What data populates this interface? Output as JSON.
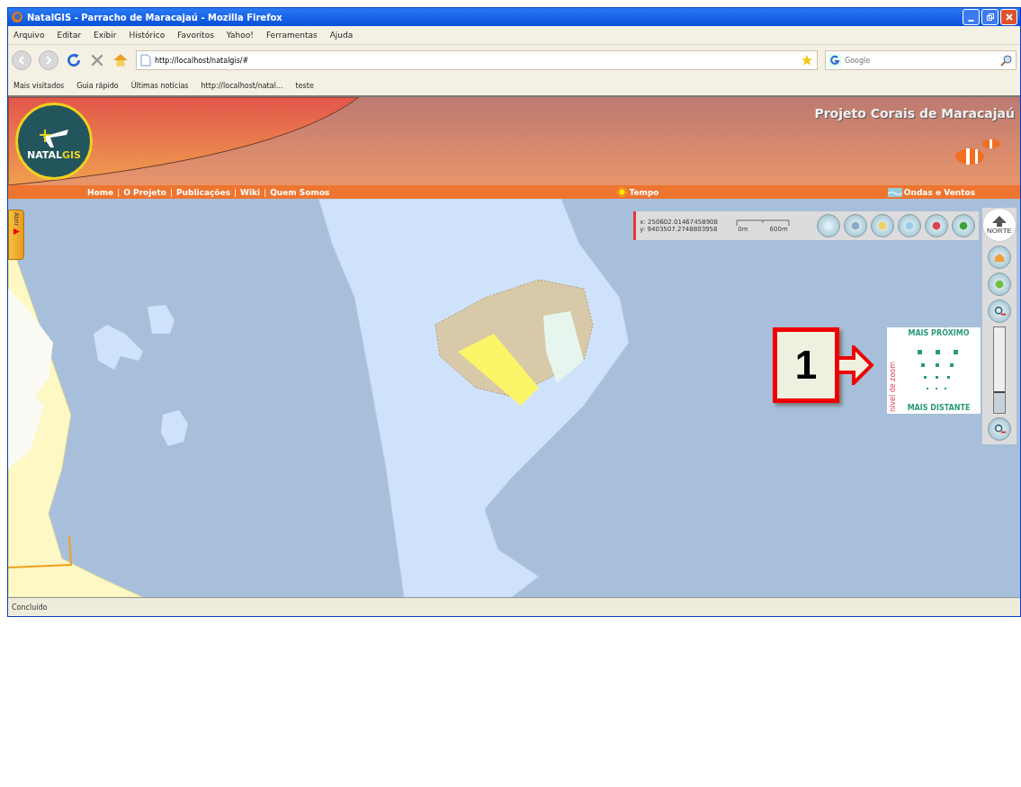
{
  "window": {
    "title": "NatalGIS - Parracho de Maracajaú - Mozilla Firefox"
  },
  "menu": [
    "Arquivo",
    "Editar",
    "Exibir",
    "Histórico",
    "Favoritos",
    "Yahoo!",
    "Ferramentas",
    "Ajuda"
  ],
  "address": {
    "value": "http://localhost/natalgis/#"
  },
  "search": {
    "placeholder": "Google"
  },
  "bookmarks": [
    "Mais visitados",
    "Guia rápido",
    "Últimas notícias",
    "http://localhost/natal...",
    "teste"
  ],
  "header": {
    "logo": "NATAL",
    "logo_accent": "GIS",
    "title": "Projeto Corais de Maracajaú"
  },
  "nav": {
    "links": [
      "Home",
      "O Projeto",
      "Publicações",
      "Wiki",
      "Quem Somos"
    ],
    "separator": "|",
    "weather": "Tempo",
    "waves": "Ondas e Ventos"
  },
  "map": {
    "side_tab": "Abrir",
    "coords": [
      "x: 250602.01467458908",
      "y: 9403507.2748803958"
    ],
    "scale": [
      "0m",
      "600m"
    ],
    "north": "NORTE",
    "zoom": {
      "near": "MAIS PRÓXIMO",
      "far": "MAIS DISTANTE",
      "label": "nível de zoom",
      "level": 0.25
    },
    "callout": "1"
  },
  "status_bar": "Concluído"
}
